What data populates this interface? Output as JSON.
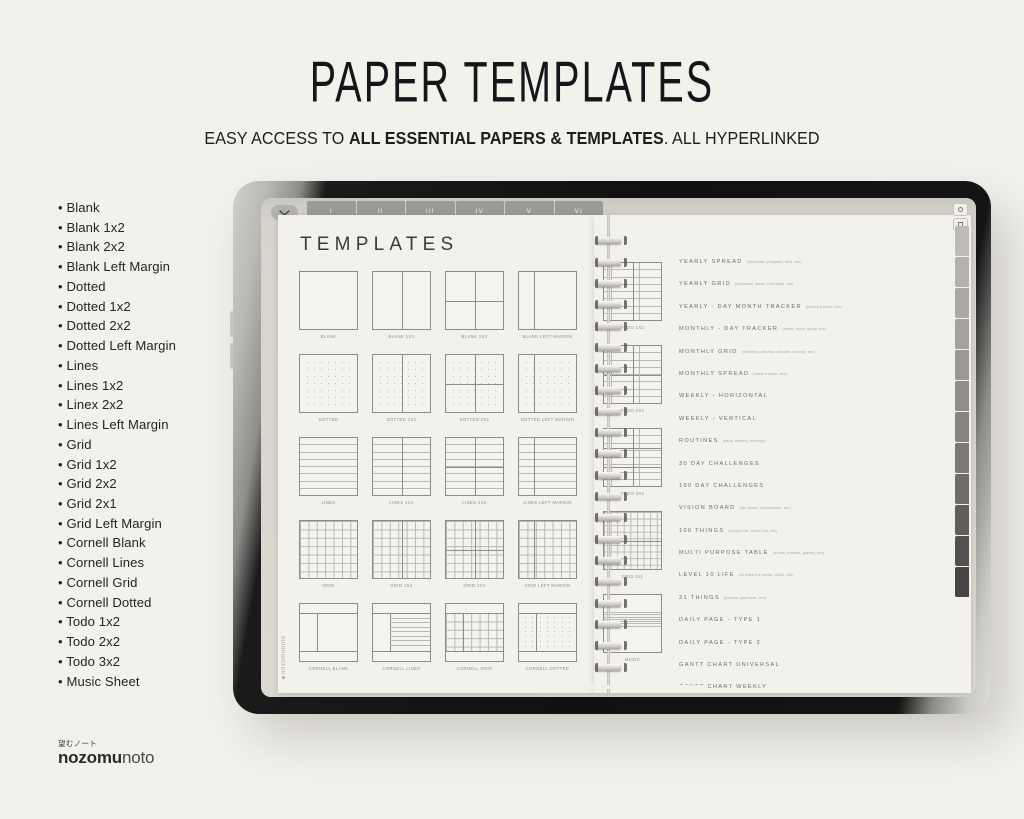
{
  "header": {
    "title": "PAPER TEMPLATES",
    "subtitle_pre": "EASY ACCESS TO ",
    "subtitle_strong": "ALL ESSENTIAL PAPERS & TEMPLATES",
    "subtitle_post": ". ALL HYPERLINKED"
  },
  "brand": {
    "jp": "望むノート",
    "bold": "nozomu",
    "light": "noto",
    "watermark": "nozomunoto"
  },
  "left_list": [
    "Blank",
    "Blank 1x2",
    "Blank 2x2",
    "Blank Left Margin",
    "Dotted",
    "Dotted 1x2",
    "Dotted 2x2",
    "Dotted Left Margin",
    "Lines",
    "Lines 1x2",
    "Linex 2x2",
    "Lines Left Margin",
    "Grid",
    "Grid 1x2",
    "Grid 2x2",
    "Grid 2x1",
    "Grid Left Margin",
    "Cornell Blank",
    "Cornell Lines",
    "Cornell Grid",
    "Cornell Dotted",
    "Todo 1x2",
    "Todo 2x2",
    "Todo 3x2",
    "Music Sheet"
  ],
  "tablet": {
    "top_tabs": [
      "I",
      "II",
      "III",
      "IV",
      "V",
      "VI"
    ],
    "page_title": "TEMPLATES",
    "thumbnails": [
      {
        "label": "BLANK",
        "kind": "blank"
      },
      {
        "label": "BLANK 1X2",
        "kind": "blank-1x2"
      },
      {
        "label": "BLANK 2X2",
        "kind": "blank-2x2"
      },
      {
        "label": "BLANK LEFT MARGIN",
        "kind": "blank-margin"
      },
      {
        "label": "DOTTED",
        "kind": "dotted"
      },
      {
        "label": "DOTTED 1X2",
        "kind": "dotted-1x2"
      },
      {
        "label": "DOTTED 2X2",
        "kind": "dotted-2x2"
      },
      {
        "label": "DOTTED LEFT MARGIN",
        "kind": "dotted-margin"
      },
      {
        "label": "LINES",
        "kind": "lines"
      },
      {
        "label": "LINES 1X2",
        "kind": "lines-1x2"
      },
      {
        "label": "LINES 2X2",
        "kind": "lines-2x2"
      },
      {
        "label": "LINES LEFT MARGIN",
        "kind": "lines-margin"
      },
      {
        "label": "GRID",
        "kind": "grid"
      },
      {
        "label": "GRID 1X2",
        "kind": "grid-1x2"
      },
      {
        "label": "GRID 2X2",
        "kind": "grid-2x2"
      },
      {
        "label": "GRID LEFT MARGIN",
        "kind": "grid-margin"
      },
      {
        "label": "CORNELL BLANK",
        "kind": "cornell-blank"
      },
      {
        "label": "CORNELL LINES",
        "kind": "cornell-lines"
      },
      {
        "label": "CORNELL GRID",
        "kind": "cornell-grid"
      },
      {
        "label": "CORNELL DOTTED",
        "kind": "cornell-dotted"
      }
    ],
    "right_thumbnails": [
      {
        "label": "TODO 1X2",
        "kind": "todo-1x2"
      },
      {
        "label": "TODO 2X2",
        "kind": "todo-2x2"
      },
      {
        "label": "TODO 3X2",
        "kind": "todo-3x2"
      },
      {
        "label": "GRID 2x1",
        "kind": "grid-2x1"
      },
      {
        "label": "MUSIC",
        "kind": "music"
      }
    ],
    "right_list": [
      {
        "name": "YEARLY SPREAD",
        "note": "(checklist, progress, bills, etc)"
      },
      {
        "name": "YEARLY GRID",
        "note": "(important dates, birthdays, etc)"
      },
      {
        "name": "YEARLY - DAY MONTH TRACKER",
        "note": "(period tracker, etc)"
      },
      {
        "name": "MONTHLY - DAY TRACKER",
        "note": "(sleep, work, study, etc)"
      },
      {
        "name": "MONTHLY GRID",
        "note": "(monthly overview, planner, events, etc)"
      },
      {
        "name": "MONTHLY SPREAD",
        "note": "(habit tracker, etc)"
      },
      {
        "name": "WEEKLY - HORIZONTAL",
        "note": ""
      },
      {
        "name": "WEEKLY - VERTICAL",
        "note": ""
      },
      {
        "name": "ROUTINES",
        "note": "(daily, weekly, monthly)"
      },
      {
        "name": "30 DAY CHALLENGES",
        "note": ""
      },
      {
        "name": "100 DAY CHALLENGES",
        "note": ""
      },
      {
        "name": "VISION BOARD",
        "note": "(life goals, inspirations, etc)"
      },
      {
        "name": "100 THINGS",
        "note": "(bucket list, travel list, etc)"
      },
      {
        "name": "MULTI PURPOSE TABLE",
        "note": "(books, movies, games, etc)"
      },
      {
        "name": "LEVEL 10 LIFE",
        "note": "(to track life areas, skills, etc)"
      },
      {
        "name": "31 THINGS",
        "note": "(journal, gratitude, etc)"
      },
      {
        "name": "DAILY PAGE - TYPE 1",
        "note": ""
      },
      {
        "name": "DAILY PAGE - TYPE 2",
        "note": ""
      },
      {
        "name": "GANTT CHART UNIVERSAL",
        "note": ""
      },
      {
        "name": "GANTT CHART WEEKLY",
        "note": ""
      }
    ],
    "side_tab_colors": [
      "#bcbbb7",
      "#b3b2ae",
      "#aaa9a5",
      "#a2a19d",
      "#9a9995",
      "#8f8e8a",
      "#85847f",
      "#7a7974",
      "#6d6c68",
      "#5f5e5a",
      "#525150",
      "#464544"
    ]
  },
  "colors": {
    "background": "#f2f1ec",
    "paper": "#f2f1ec",
    "ink": "#16161a",
    "muted": "#8c8a85"
  }
}
